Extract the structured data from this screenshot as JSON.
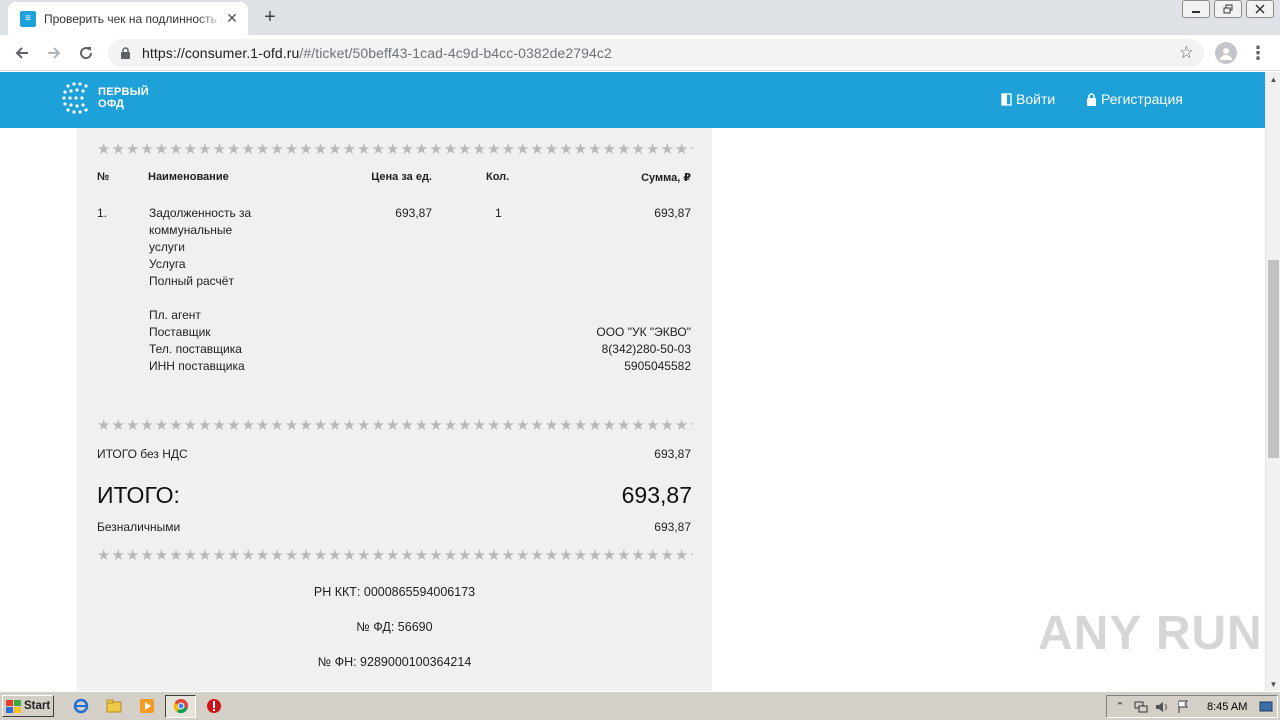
{
  "browser": {
    "tab_title": "Проверить чек на подлинность онлайн",
    "tab_close": "✕",
    "new_tab": "+",
    "url_host": "https://consumer.1-ofd.ru",
    "url_path": "/#/ticket/50beff43-1cad-4c9d-b4cc-0382de2794c2"
  },
  "site": {
    "logo_line1": "ПЕРВЫЙ",
    "logo_line2": "ОФД",
    "login": "Войти",
    "register": "Регистрация",
    "brand_color": "#1ea0d9"
  },
  "receipt": {
    "stars": "★★★★★★★★★★★★★★★★★★★★★★★★★★★★★★★★★★★★★★★★★★★★★★★★★★★★★★★★★★★★",
    "columns": {
      "num": "№",
      "name": "Наименование",
      "price": "Цена за ед.",
      "qty": "Кол.",
      "sum": "Сумма, ₽"
    },
    "item": {
      "num": "1.",
      "lines": [
        "Задолженность за",
        "коммунальные",
        "услуги",
        "Услуга",
        "Полный расчёт"
      ],
      "price": "693,87",
      "qty": "1",
      "sum": "693,87"
    },
    "agent": {
      "labels": [
        "Пл. агент",
        "Поставщик",
        "Тел. поставщика",
        "ИНН поставщика"
      ],
      "values": [
        "",
        "ООО \"УК \"ЭКВО\"",
        "8(342)280-50-03",
        "5905045582"
      ]
    },
    "subtotal_label": "ИТОГО без НДС",
    "subtotal_value": "693,87",
    "total_label": "ИТОГО:",
    "total_value": "693,87",
    "payment_label": "Безналичными",
    "payment_value": "693,87",
    "rn_kkt": "РН ККТ: 0000865594006173",
    "fd": "№ ФД: 56690",
    "fn": "№ ФН: 9289000100364214"
  },
  "watermark": "ANY RUN",
  "taskbar": {
    "start": "Start",
    "clock": "8:45 AM"
  }
}
